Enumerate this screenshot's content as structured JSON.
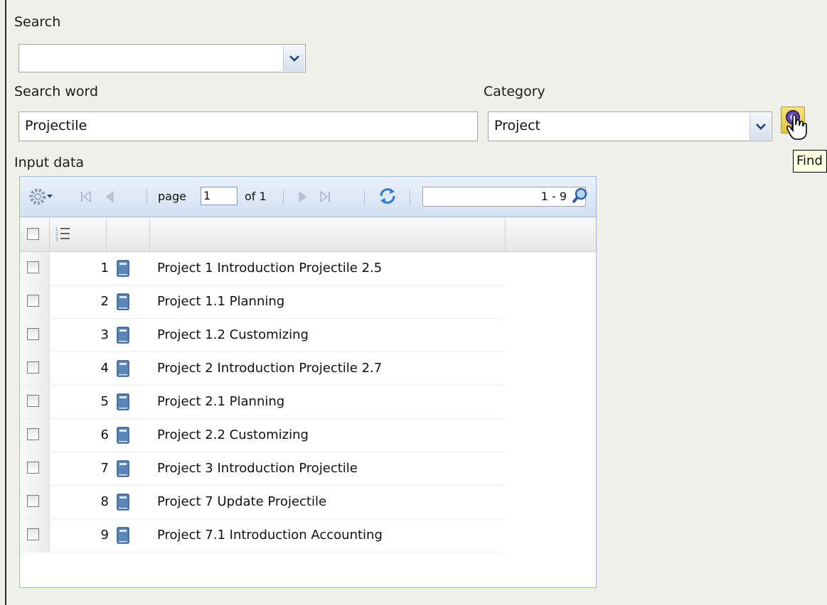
{
  "labels": {
    "search": "Search",
    "search_word": "Search word",
    "category": "Category",
    "input_data": "Input data"
  },
  "search": {
    "value": ""
  },
  "search_word": {
    "value": "Projectile"
  },
  "category": {
    "value": "Project"
  },
  "find_tooltip": "Find",
  "pager": {
    "page_label": "page",
    "page_value": "1",
    "of_label": "of 1",
    "range": "1 - 9"
  },
  "rows": [
    {
      "num": "1",
      "title": "Project 1 Introduction Projectile 2.5"
    },
    {
      "num": "2",
      "title": "Project 1.1 Planning"
    },
    {
      "num": "3",
      "title": "Project 1.2 Customizing"
    },
    {
      "num": "4",
      "title": "Project 2 Introduction Projectile 2.7"
    },
    {
      "num": "5",
      "title": "Project 2.1 Planning"
    },
    {
      "num": "6",
      "title": "Project 2.2 Customizing"
    },
    {
      "num": "7",
      "title": "Project 3 Introduction Projectile"
    },
    {
      "num": "8",
      "title": "Project 7 Update Projectile"
    },
    {
      "num": "9",
      "title": "Project 7.1 Introduction Accounting"
    }
  ],
  "icons": [
    "gear-icon",
    "first-page-icon",
    "prev-page-icon",
    "next-page-icon",
    "last-page-icon",
    "refresh-icon",
    "search-range-icon",
    "numbered-list-icon",
    "book-icon",
    "find-icon",
    "hand-cursor-icon",
    "chevron-down-icon"
  ],
  "colors": {
    "find_button": "#e8c94a",
    "grid_border": "#99bbe8",
    "book": "#5b86b8"
  }
}
